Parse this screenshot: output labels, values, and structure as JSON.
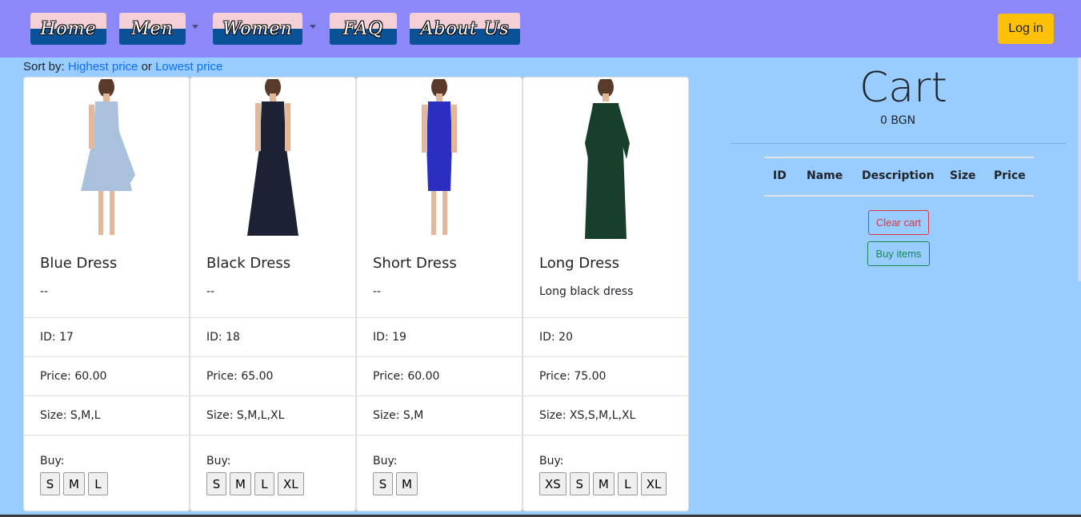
{
  "nav": {
    "items": [
      {
        "label": "Home"
      },
      {
        "label": "Men",
        "dropdown": true
      },
      {
        "label": "Women",
        "dropdown": true
      },
      {
        "label": "FAQ"
      },
      {
        "label": "About Us"
      }
    ],
    "login_label": "Log in"
  },
  "sort": {
    "prefix": "Sort by:",
    "highest": "Highest price",
    "or": "or",
    "lowest": "Lowest price"
  },
  "products": [
    {
      "title": "Blue Dress",
      "description": "--",
      "id": "ID: 17",
      "price": "Price: 60.00",
      "size": "Size: S,M,L",
      "buy_label": "Buy:",
      "sizes": [
        "S",
        "M",
        "L"
      ],
      "dress_color": "#a9c1dc"
    },
    {
      "title": "Black Dress",
      "description": "--",
      "id": "ID: 18",
      "price": "Price: 65.00",
      "size": "Size: S,M,L,XL",
      "buy_label": "Buy:",
      "sizes": [
        "S",
        "M",
        "L",
        "XL"
      ],
      "dress_color": "#1c2233"
    },
    {
      "title": "Short Dress",
      "description": "--",
      "id": "ID: 19",
      "price": "Price: 60.00",
      "size": "Size: S,M",
      "buy_label": "Buy:",
      "sizes": [
        "S",
        "M"
      ],
      "dress_color": "#2a2fc0"
    },
    {
      "title": "Long Dress",
      "description": "Long black dress",
      "id": "ID: 20",
      "price": "Price: 75.00",
      "size": "Size: XS,S,M,L,XL",
      "buy_label": "Buy:",
      "sizes": [
        "XS",
        "S",
        "M",
        "L",
        "XL"
      ],
      "dress_color": "#173f2c"
    }
  ],
  "cart": {
    "title": "Cart",
    "total": "0 BGN",
    "columns": [
      "ID",
      "Name",
      "Description",
      "Size",
      "Price"
    ],
    "clear_label": "Clear cart",
    "buy_label": "Buy items"
  },
  "colors": {
    "navbar": "#8c88f8",
    "background": "#99ccff",
    "login": "#ffc107",
    "link": "#0d6efd",
    "danger": "#dc3545",
    "success": "#198754"
  }
}
